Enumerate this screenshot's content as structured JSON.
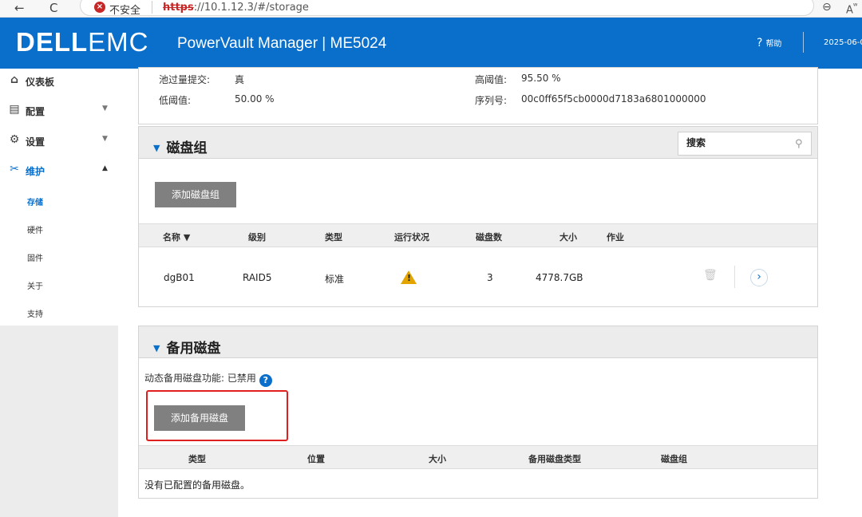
{
  "browser": {
    "back_icon": "←",
    "reload_icon": "C",
    "insecure_label": "不安全",
    "url_scheme": "https",
    "url_rest": "://10.1.12.3/#/storage",
    "zoom_icon": "⊖",
    "read_aloud_icon": "A",
    "read_aloud_sup": "ʷ"
  },
  "header": {
    "logo_bold": "DELL",
    "logo_light": "EMC",
    "product": "PowerVault Manager | ME5024",
    "help_icon": "?",
    "help_label": "帮助",
    "date": "2025-06-0"
  },
  "sidebar": {
    "items": [
      {
        "label": "仪表板",
        "icon": "⌂"
      },
      {
        "label": "配置",
        "icon": "▤"
      },
      {
        "label": "设置",
        "icon": "⚙"
      },
      {
        "label": "维护",
        "icon": "✂"
      }
    ],
    "sub_items": [
      "存储",
      "硬件",
      "固件",
      "关于",
      "支持"
    ]
  },
  "pool_info": {
    "overcommit_label": "池过量提交:",
    "overcommit_value": "真",
    "low_threshold_label": "低阈值:",
    "low_threshold_value": "50.00 %",
    "high_threshold_label": "高阈值:",
    "high_threshold_value": "95.50 %",
    "serial_label": "序列号:",
    "serial_value": "00c0ff65f5cb0000d7183a6801000000"
  },
  "disk_groups": {
    "title": "磁盘组",
    "search_placeholder": "搜索",
    "add_button": "添加磁盘组",
    "columns": [
      "名称 ▼",
      "级别",
      "类型",
      "运行状况",
      "磁盘数",
      "大小",
      "作业"
    ],
    "rows": [
      {
        "name": "dgB01",
        "level": "RAID5",
        "type": "标准",
        "health": "warning",
        "disk_count": "3",
        "size": "4778.7GB",
        "job": ""
      }
    ]
  },
  "spares": {
    "title": "备用磁盘",
    "dynamic_label": "动态备用磁盘功能: 已禁用",
    "help_icon": "?",
    "add_button": "添加备用磁盘",
    "columns": [
      "类型",
      "位置",
      "大小",
      "备用磁盘类型",
      "磁盘组"
    ],
    "empty_text": "没有已配置的备用磁盘。"
  },
  "colors": {
    "header_blue": "#0a6fcb",
    "warning": "#e3a400",
    "highlight_red": "#e02020"
  }
}
